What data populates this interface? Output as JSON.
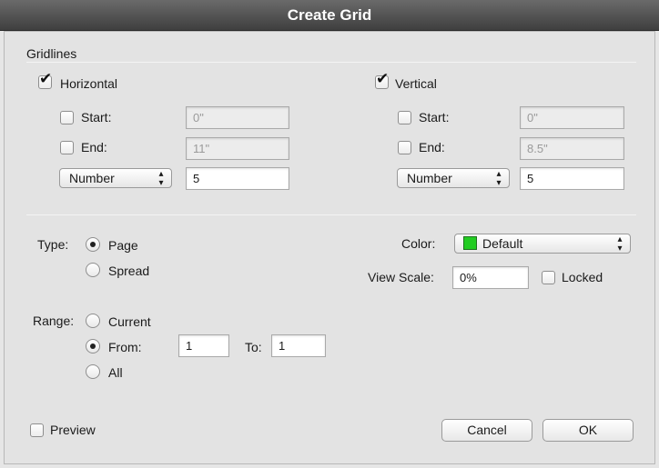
{
  "window": {
    "title": "Create Grid"
  },
  "gridlines": {
    "section_label": "Gridlines",
    "horizontal": {
      "label": "Horizontal",
      "checked": true,
      "start_label": "Start:",
      "start_value": "0\"",
      "end_label": "End:",
      "end_value": "11\"",
      "mode_select": "Number",
      "count": "5"
    },
    "vertical": {
      "label": "Vertical",
      "checked": true,
      "start_label": "Start:",
      "start_value": "0\"",
      "end_label": "End:",
      "end_value": "8.5\"",
      "mode_select": "Number",
      "count": "5"
    }
  },
  "type": {
    "label": "Type:",
    "options": [
      "Page",
      "Spread"
    ],
    "selected": "Page"
  },
  "color": {
    "label": "Color:",
    "value": "Default",
    "swatch": "#22cc22"
  },
  "view_scale": {
    "label": "View Scale:",
    "value": "0%",
    "locked_label": "Locked",
    "locked": false
  },
  "range": {
    "label": "Range:",
    "current_label": "Current",
    "from_label": "From:",
    "from_value": "1",
    "to_label": "To:",
    "to_value": "1",
    "all_label": "All",
    "selected": "From"
  },
  "footer": {
    "preview_label": "Preview",
    "preview_checked": false,
    "cancel_label": "Cancel",
    "ok_label": "OK"
  }
}
